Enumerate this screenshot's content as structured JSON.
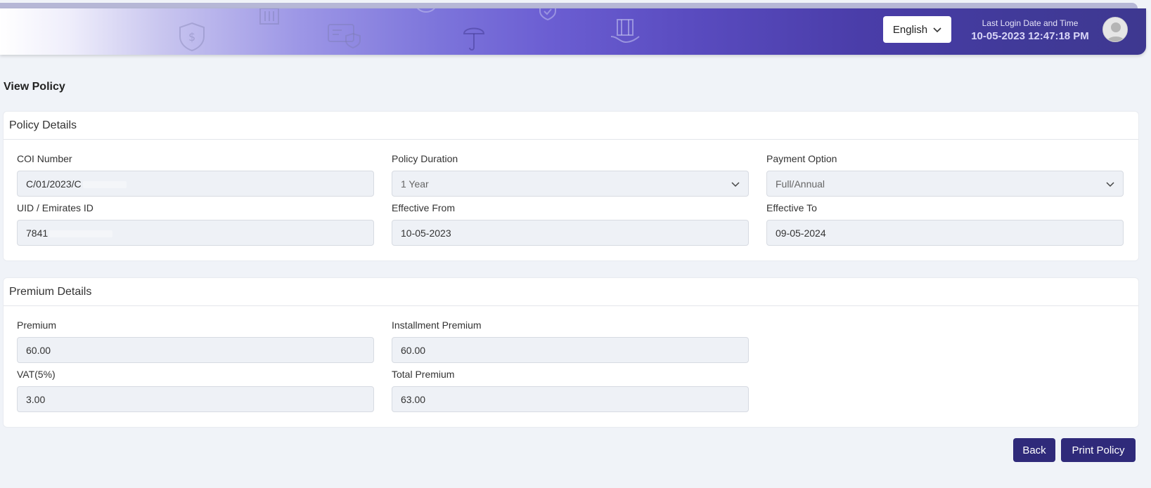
{
  "header": {
    "language": "English",
    "last_login_label": "Last Login Date and Time",
    "last_login_value": "10-05-2023 12:47:18 PM"
  },
  "page": {
    "title": "View Policy"
  },
  "policy_details": {
    "heading": "Policy Details",
    "coi_number": {
      "label": "COI Number",
      "value": "C/01/2023/C"
    },
    "policy_duration": {
      "label": "Policy Duration",
      "value": "1 Year"
    },
    "payment_option": {
      "label": "Payment Option",
      "value": "Full/Annual"
    },
    "uid": {
      "label": "UID / Emirates ID",
      "value": "7841"
    },
    "effective_from": {
      "label": "Effective From",
      "value": "10-05-2023"
    },
    "effective_to": {
      "label": "Effective To",
      "value": "09-05-2024"
    }
  },
  "premium_details": {
    "heading": "Premium Details",
    "premium": {
      "label": "Premium",
      "value": "60.00"
    },
    "installment_premium": {
      "label": "Installment Premium",
      "value": "60.00"
    },
    "vat": {
      "label": "VAT(5%)",
      "value": "3.00"
    },
    "total_premium": {
      "label": "Total Premium",
      "value": "63.00"
    }
  },
  "actions": {
    "back": "Back",
    "print": "Print Policy"
  },
  "colors": {
    "primary_button": "#2f2a7a",
    "header_dark": "#3e3890",
    "page_bg": "#f0f3f8"
  },
  "icons": [
    "shield-dollar-icon",
    "building-icon",
    "id-card-shield-icon",
    "umbrella-icon",
    "hand-house-icon",
    "chevron-down-icon",
    "user-avatar-icon"
  ]
}
